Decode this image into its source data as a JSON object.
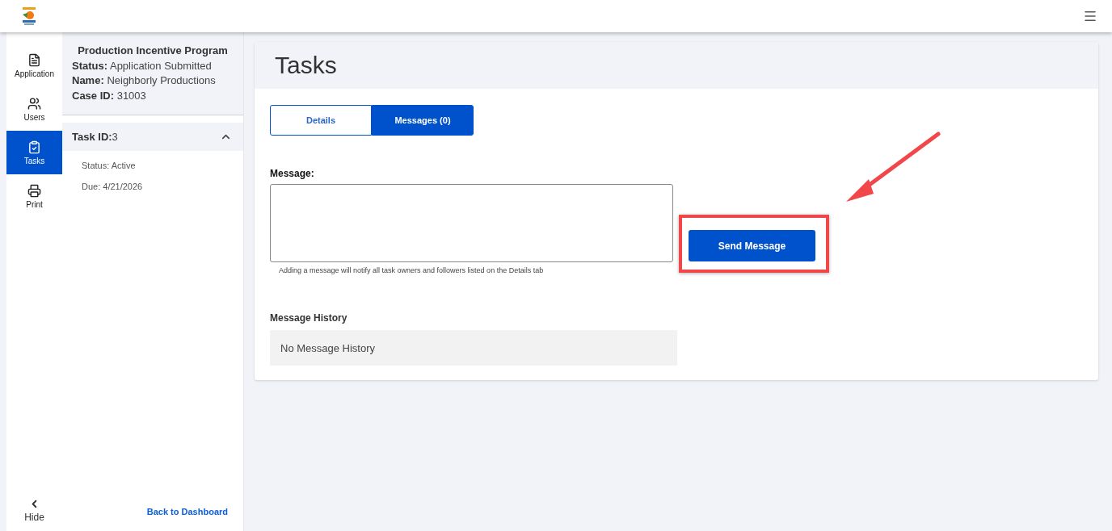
{
  "nav": {
    "items": [
      {
        "label": "Application",
        "selected": false
      },
      {
        "label": "Users",
        "selected": false
      },
      {
        "label": "Tasks",
        "selected": true
      },
      {
        "label": "Print",
        "selected": false
      }
    ],
    "hide": "Hide"
  },
  "case": {
    "program": "Production Incentive Program",
    "fields": [
      {
        "label": "Status:",
        "value": "Application Submitted"
      },
      {
        "label": "Name:",
        "value": "Neighborly Productions"
      },
      {
        "label": "Case ID:",
        "value": "31003"
      }
    ]
  },
  "task": {
    "title": "Task ID:",
    "id": "3",
    "expanded": true,
    "lines": [
      "Status: Active",
      "Due: 4/21/2026"
    ]
  },
  "back_link": "Back to Dashboard",
  "page_title": "Tasks",
  "tabs": [
    {
      "label": "Details",
      "selected": false
    },
    {
      "label": "Messages (0)",
      "selected": true
    }
  ],
  "message": {
    "label": "Message:",
    "hint": "Adding a message will notify all task owners and followers listed on the Details tab",
    "button": "Send Message"
  },
  "history": {
    "title": "Message History",
    "empty": "No Message History"
  }
}
